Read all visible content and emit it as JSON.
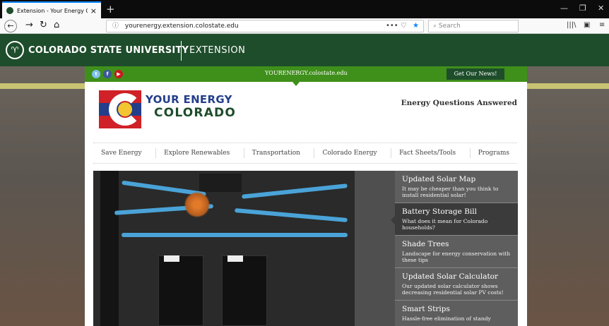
{
  "browser": {
    "tab_title": "Extension - Your Energy Colora",
    "tab_close": "×",
    "new_tab": "+",
    "url": "yourenergy.extension.colostate.edu",
    "url_actions": "•••",
    "search_placeholder": "Search",
    "icons": [
      "back-icon",
      "forward-icon",
      "reload-icon",
      "home-icon",
      "info-icon",
      "pocket-icon",
      "bookmark-star-icon",
      "search-icon",
      "library-icon",
      "sidebar-icon",
      "menu-icon"
    ]
  },
  "csu": {
    "name": "COLORADO STATE UNIVERSITY",
    "unit": "EXTENSION"
  },
  "site": {
    "domain": "YOURENERGY.colostate.edu",
    "news_button": "Get Our News!",
    "brand_line1": "YOUR ENERGY",
    "brand_line2": "COLORADO",
    "tagline": "Energy Questions Answered",
    "nav": [
      "Save Energy",
      "Explore Renewables",
      "Transportation",
      "Colorado Energy",
      "Fact Sheets/Tools",
      "Programs"
    ],
    "features": [
      {
        "title": "Updated Solar Map",
        "desc": "It may be cheaper than you think to install residential solar!"
      },
      {
        "title": "Battery Storage Bill",
        "desc": "What does it mean for Colorado households?"
      },
      {
        "title": "Shade Trees",
        "desc": "Landscape for energy conservation with these tips"
      },
      {
        "title": "Updated Solar Calculator",
        "desc": "Our updated solar calculator shows decreasing residential solar PV costs!"
      },
      {
        "title": "Smart Strips",
        "desc": "Hassle-free elimination of standy"
      }
    ],
    "active_feature": 1
  },
  "colors": {
    "csu_green": "#1e4d2b",
    "bar_green": "#3f8f1b",
    "gold": "#c8c372",
    "brand_blue": "#233e8a",
    "brand_red": "#cf2127",
    "brand_yellow": "#f3c530"
  }
}
